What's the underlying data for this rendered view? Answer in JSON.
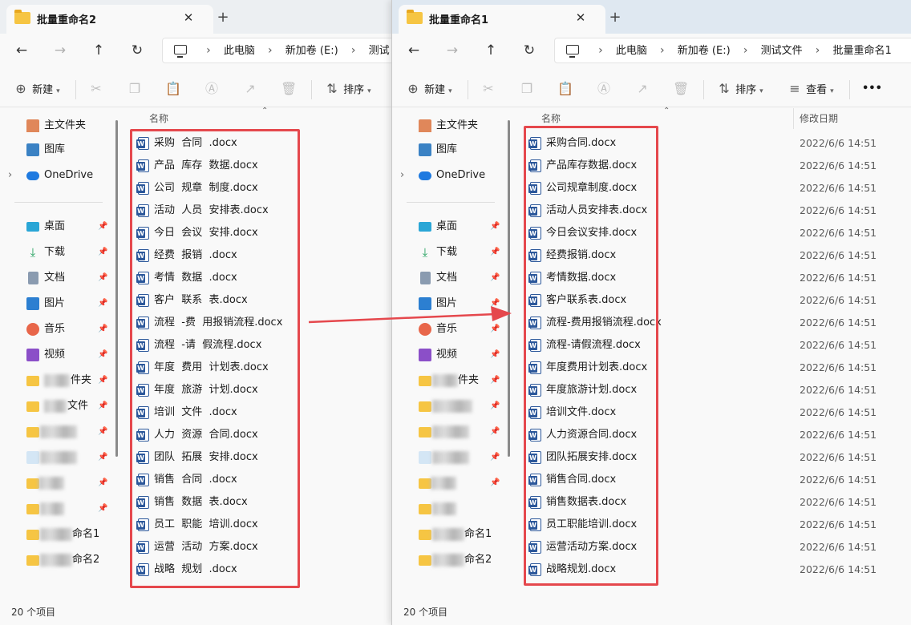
{
  "left_window": {
    "tab_title": "批量重命名2",
    "close_glyph": "✕",
    "add_glyph": "+",
    "breadcrumb": [
      "此电脑",
      "新加卷 (E:)",
      "测试"
    ],
    "toolbar": {
      "new_label": "新建",
      "sort_label": "排序"
    },
    "column_name": "名称",
    "files": [
      "采购  合同  .docx",
      "产品  库存  数据.docx",
      "公司  规章  制度.docx",
      "活动  人员  安排表.docx",
      "今日  会议  安排.docx",
      "经费  报销  .docx",
      "考情  数据  .docx",
      "客户  联系  表.docx",
      "流程  -费  用报销流程.docx",
      "流程  -请  假流程.docx",
      "年度  费用  计划表.docx",
      "年度  旅游  计划.docx",
      "培训  文件  .docx",
      "人力  资源  合同.docx",
      "团队  拓展  安排.docx",
      "销售  合同  .docx",
      "销售  数据  表.docx",
      "员工  职能  培训.docx",
      "运营  活动  方案.docx",
      "战略  规划  .docx"
    ],
    "status": "20 个项目"
  },
  "right_window": {
    "tab_title": "批量重命名1",
    "close_glyph": "✕",
    "add_glyph": "+",
    "breadcrumb": [
      "此电脑",
      "新加卷 (E:)",
      "测试文件",
      "批量重命名1"
    ],
    "toolbar": {
      "new_label": "新建",
      "sort_label": "排序",
      "view_label": "查看",
      "more_label": "•••"
    },
    "column_name": "名称",
    "column_date": "修改日期",
    "files": [
      "采购合同.docx",
      "产品库存数据.docx",
      "公司规章制度.docx",
      "活动人员安排表.docx",
      "今日会议安排.docx",
      "经费报销.docx",
      "考情数据.docx",
      "客户联系表.docx",
      "流程-费用报销流程.docx",
      "流程-请假流程.docx",
      "年度费用计划表.docx",
      "年度旅游计划.docx",
      "培训文件.docx",
      "人力资源合同.docx",
      "团队拓展安排.docx",
      "销售合同.docx",
      "销售数据表.docx",
      "员工职能培训.docx",
      "运营活动方案.docx",
      "战略规划.docx"
    ],
    "date": "2022/6/6 14:51",
    "status": "20 个项目"
  },
  "sidebar": {
    "home": "主文件夹",
    "gallery": "图库",
    "onedrive": "OneDrive",
    "desktop": "桌面",
    "downloads": "下载",
    "documents": "文档",
    "pictures": "图片",
    "music": "音乐",
    "videos": "视频",
    "blur1_tail": "件夹",
    "blur2_tail": "文件",
    "blur8_tail": "命名1",
    "blur9_tail": "命名2"
  },
  "colors": {
    "accent_red": "#e5484d",
    "word_blue": "#2b579a",
    "folder_yellow": "#f6c543"
  }
}
